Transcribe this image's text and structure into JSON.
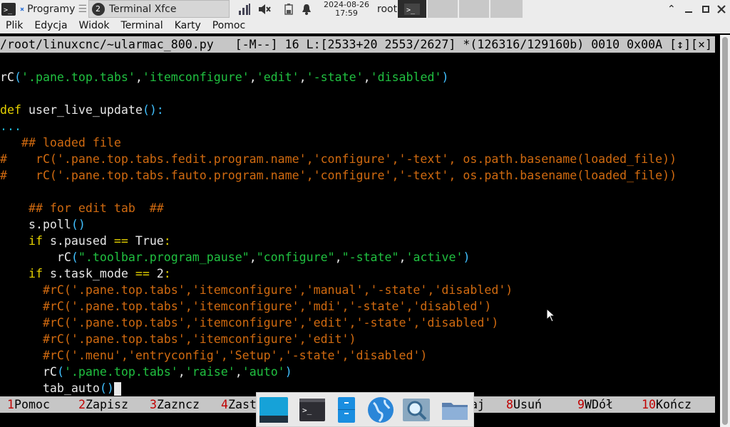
{
  "panel": {
    "app_menu_label": "Programy",
    "window_title": "Terminal Xfce",
    "task_badge": "2",
    "date": "2024-08-26",
    "time": "17:59",
    "user": "root"
  },
  "menubar": [
    "Plik",
    "Edycja",
    "Widok",
    "Terminal",
    "Karty",
    "Pomoc"
  ],
  "editor": {
    "status_line": "/root/linuxcnc/~ularmac_800.py   [-M--] 16 L:[2533+20 2553/2627] *(126316/129160b) 0010 0x00A [↕][×]",
    "lines": [
      [],
      [
        [
          "w",
          "rC"
        ],
        [
          "b",
          "("
        ],
        [
          "g",
          "'.pane.top.tabs'"
        ],
        [
          "w",
          ","
        ],
        [
          "g",
          "'itemconfigure'"
        ],
        [
          "w",
          ","
        ],
        [
          "g",
          "'edit'"
        ],
        [
          "w",
          ","
        ],
        [
          "g",
          "'-state'"
        ],
        [
          "w",
          ","
        ],
        [
          "g",
          "'disabled'"
        ],
        [
          "b",
          ")"
        ]
      ],
      [],
      [
        [
          "y",
          "def"
        ],
        [
          "w",
          " user_live_update"
        ],
        [
          "b",
          "():"
        ]
      ],
      [
        [
          "c",
          "..."
        ]
      ],
      [
        [
          "o",
          "   ## loaded file"
        ]
      ],
      [
        [
          "o",
          "#    rC('.pane.top.tabs.fedit.program.name','configure','-text', os.path.basename(loaded_file))"
        ]
      ],
      [
        [
          "o",
          "#    rC('.pane.top.tabs.fauto.program.name','configure','-text', os.path.basename(loaded_file))"
        ]
      ],
      [],
      [
        [
          "o",
          "    ## for edit tab  ##"
        ]
      ],
      [
        [
          "w",
          "    s.poll"
        ],
        [
          "b",
          "()"
        ]
      ],
      [
        [
          "y",
          "    if"
        ],
        [
          "w",
          " s.paused "
        ],
        [
          "y",
          "=="
        ],
        [
          "w",
          " True"
        ],
        [
          "y",
          ":"
        ]
      ],
      [
        [
          "w",
          "        rC"
        ],
        [
          "b",
          "("
        ],
        [
          "g",
          "\".toolbar.program_pause\""
        ],
        [
          "w",
          ","
        ],
        [
          "g",
          "\"configure\""
        ],
        [
          "w",
          ","
        ],
        [
          "g",
          "\"-state\""
        ],
        [
          "w",
          ","
        ],
        [
          "g",
          "'active'"
        ],
        [
          "b",
          ")"
        ]
      ],
      [
        [
          "y",
          "    if"
        ],
        [
          "w",
          " s.task_mode "
        ],
        [
          "y",
          "=="
        ],
        [
          "w",
          " 2"
        ],
        [
          "y",
          ":"
        ]
      ],
      [
        [
          "o",
          "      #rC('.pane.top.tabs','itemconfigure','manual','-state','disabled')"
        ]
      ],
      [
        [
          "o",
          "      #rC('.pane.top.tabs','itemconfigure','mdi','-state','disabled')"
        ]
      ],
      [
        [
          "o",
          "      #rC('.pane.top.tabs','itemconfigure','edit','-state','disabled')"
        ]
      ],
      [
        [
          "o",
          "      #rC('.pane.top.tabs','itemconfigure','edit')"
        ]
      ],
      [
        [
          "o",
          "      #rC('.menu','entryconfig','Setup','-state','disabled')"
        ]
      ],
      [
        [
          "w",
          "      rC"
        ],
        [
          "b",
          "("
        ],
        [
          "g",
          "'.pane.top.tabs'"
        ],
        [
          "w",
          ","
        ],
        [
          "g",
          "'raise'"
        ],
        [
          "w",
          ","
        ],
        [
          "g",
          "'auto'"
        ],
        [
          "b",
          ")"
        ]
      ],
      [
        [
          "w",
          "      tab_auto"
        ],
        [
          "b",
          "()"
        ]
      ]
    ]
  },
  "fkeys": [
    {
      "num": "1",
      "label": "Pomoc"
    },
    {
      "num": "2",
      "label": "Zapisz"
    },
    {
      "num": "3",
      "label": "Zazncz"
    },
    {
      "num": "4",
      "label": "Zast"
    },
    {
      "num": "",
      "label": "aj"
    },
    {
      "num": "8",
      "label": "Usuń"
    },
    {
      "num": "9",
      "label": "WDół"
    },
    {
      "num": "10",
      "label": "Kończ"
    }
  ],
  "dock_icons": [
    "desktop-icon",
    "terminal-icon",
    "file-manager-icon",
    "web-browser-icon",
    "app-finder-icon",
    "folder-icon"
  ]
}
